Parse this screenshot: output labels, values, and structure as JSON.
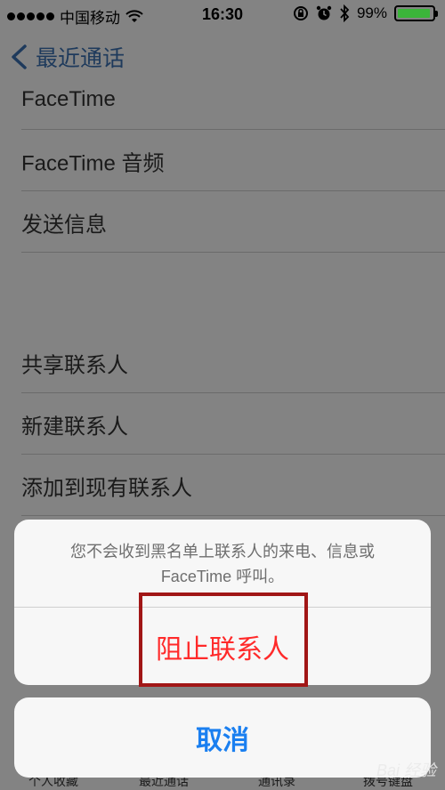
{
  "status_bar": {
    "carrier": "中国移动",
    "time": "16:30",
    "battery": "99%"
  },
  "nav": {
    "back_label": "最近通话"
  },
  "rows": [
    {
      "label": "FaceTime"
    },
    {
      "label": "FaceTime 音频"
    },
    {
      "label": "发送信息"
    },
    {
      "label": "共享联系人"
    },
    {
      "label": "新建联系人"
    },
    {
      "label": "添加到现有联系人"
    }
  ],
  "action_sheet": {
    "message_line1": "您不会收到黑名单上联系人的来电、信息或",
    "message_line2": "FaceTime 呼叫。",
    "block_label": "阻止联系人",
    "cancel_label": "取消"
  },
  "tab_bar": {
    "items": [
      "个人收藏",
      "最近通话",
      "通讯录",
      "拨号键盘"
    ]
  },
  "watermark": "Bai 经验",
  "colors": {
    "destructive": "#ff2a2a",
    "cancel": "#1a7ff0",
    "highlight_border": "#a11616",
    "battery": "#3bb53a"
  }
}
